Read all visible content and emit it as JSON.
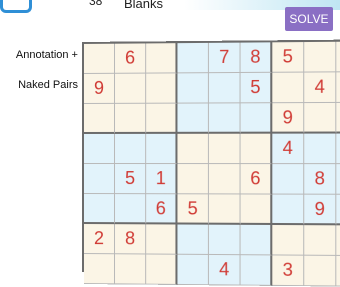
{
  "header": {
    "blank_count": "38",
    "blanks_label": "Blanks",
    "solve_label": "SOLVE",
    "accent_color": "#8a6fc4"
  },
  "sidebar": {
    "options": [
      "Annotation +",
      "Naked Pairs"
    ]
  },
  "board": {
    "rows": [
      [
        "",
        "6",
        "",
        "",
        "7",
        "8",
        "5",
        "",
        ""
      ],
      [
        "9",
        "",
        "",
        "",
        "",
        "5",
        "",
        "4",
        ""
      ],
      [
        "",
        "",
        "",
        "",
        "",
        "",
        "9",
        "",
        ""
      ],
      [
        "",
        "",
        "",
        "",
        "",
        "",
        "4",
        "",
        ""
      ],
      [
        "",
        "5",
        "1",
        "",
        "",
        "6",
        "",
        "8",
        ""
      ],
      [
        "",
        "",
        "6",
        "5",
        "",
        "",
        "",
        "9",
        ""
      ],
      [
        "2",
        "8",
        "",
        "",
        "",
        "",
        "",
        "",
        ""
      ],
      [
        "",
        "",
        "",
        "",
        "4",
        "",
        "3",
        "",
        ""
      ]
    ],
    "digit_color": "#d03a34",
    "block_colors": [
      "#fbf5e6",
      "#e2f3fb"
    ]
  }
}
